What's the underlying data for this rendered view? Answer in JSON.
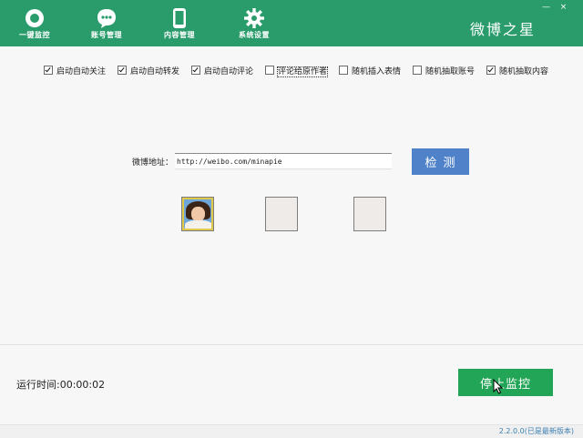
{
  "nav": {
    "items": [
      {
        "label": "一键监控",
        "icon": "circle-icon"
      },
      {
        "label": "账号管理",
        "icon": "chat-icon"
      },
      {
        "label": "内容管理",
        "icon": "phone-icon"
      },
      {
        "label": "系统设置",
        "icon": "gear-icon"
      }
    ],
    "brand": "微博之星",
    "window_controls": {
      "minimize": "—",
      "close": "×"
    }
  },
  "options": [
    {
      "label": "启动自动关注",
      "checked": true
    },
    {
      "label": "启动自动转发",
      "checked": true
    },
    {
      "label": "启动自动评论",
      "checked": true
    },
    {
      "label": "评论给原作者",
      "checked": false
    },
    {
      "label": "随机插入表情",
      "checked": false
    },
    {
      "label": "随机抽取账号",
      "checked": false
    },
    {
      "label": "随机抽取内容",
      "checked": true
    }
  ],
  "weibo": {
    "label": "微博地址：",
    "url": "http://weibo.com/minapie",
    "detect_label": "检测"
  },
  "runtime": {
    "text": "运行时间:00:00:02"
  },
  "stop_button": {
    "label": "停止监控"
  },
  "version": {
    "text": "2.2.0.0(已是最新版本)"
  },
  "colors": {
    "header": "#2a9c6b",
    "detect": "#4f82c8",
    "stop": "#22a556"
  }
}
